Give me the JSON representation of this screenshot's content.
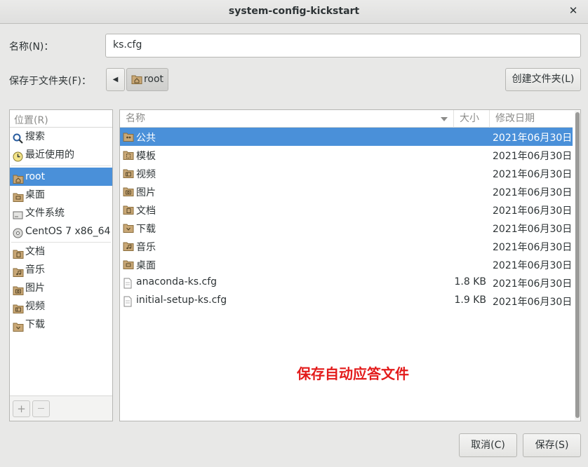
{
  "window": {
    "title": "system-config-kickstart",
    "close_glyph": "✕"
  },
  "name_field": {
    "label": "名称(N)：",
    "value": "ks.cfg"
  },
  "folder_row": {
    "label": "保存于文件夹(F)：",
    "back_glyph": "◀",
    "current": "root",
    "create_folder": "创建文件夹(L)"
  },
  "places": {
    "header": "位置(R)",
    "items": [
      {
        "label": "搜索",
        "icon": "search-icon"
      },
      {
        "label": "最近使用的",
        "icon": "recent-icon"
      },
      {
        "label": "root",
        "icon": "home-folder-icon",
        "selected": true
      },
      {
        "label": "桌面",
        "icon": "desktop-folder-icon"
      },
      {
        "label": "文件系统",
        "icon": "drive-icon"
      },
      {
        "label": "CentOS 7 x86_64",
        "icon": "disc-icon"
      },
      {
        "label": "文档",
        "icon": "documents-folder-icon"
      },
      {
        "label": "音乐",
        "icon": "music-folder-icon"
      },
      {
        "label": "图片",
        "icon": "pictures-folder-icon"
      },
      {
        "label": "视频",
        "icon": "videos-folder-icon"
      },
      {
        "label": "下载",
        "icon": "downloads-folder-icon"
      }
    ],
    "add_glyph": "+",
    "remove_glyph": "—"
  },
  "files": {
    "columns": {
      "name": "名称",
      "size": "大小",
      "modified": "修改日期"
    },
    "rows": [
      {
        "name": "公共",
        "size": "",
        "modified": "2021年06月30日",
        "icon": "public-folder-icon",
        "selected": true
      },
      {
        "name": "模板",
        "size": "",
        "modified": "2021年06月30日",
        "icon": "templates-folder-icon"
      },
      {
        "name": "视频",
        "size": "",
        "modified": "2021年06月30日",
        "icon": "videos-folder-icon"
      },
      {
        "name": "图片",
        "size": "",
        "modified": "2021年06月30日",
        "icon": "pictures-folder-icon"
      },
      {
        "name": "文档",
        "size": "",
        "modified": "2021年06月30日",
        "icon": "documents-folder-icon"
      },
      {
        "name": "下载",
        "size": "",
        "modified": "2021年06月30日",
        "icon": "downloads-folder-icon"
      },
      {
        "name": "音乐",
        "size": "",
        "modified": "2021年06月30日",
        "icon": "music-folder-icon"
      },
      {
        "name": "桌面",
        "size": "",
        "modified": "2021年06月30日",
        "icon": "desktop-folder-icon"
      },
      {
        "name": "anaconda-ks.cfg",
        "size": "1.8 KB",
        "modified": "2021年06月30日",
        "icon": "text-file-icon"
      },
      {
        "name": "initial-setup-ks.cfg",
        "size": "1.9 KB",
        "modified": "2021年06月30日",
        "icon": "text-file-icon"
      }
    ]
  },
  "annotation": "保存自动应答文件",
  "buttons": {
    "cancel": "取消(C)",
    "save": "保存(S)"
  },
  "colors": {
    "selection": "#4a90d9",
    "annotation": "#e31b1b",
    "folder": "#c9a877"
  }
}
